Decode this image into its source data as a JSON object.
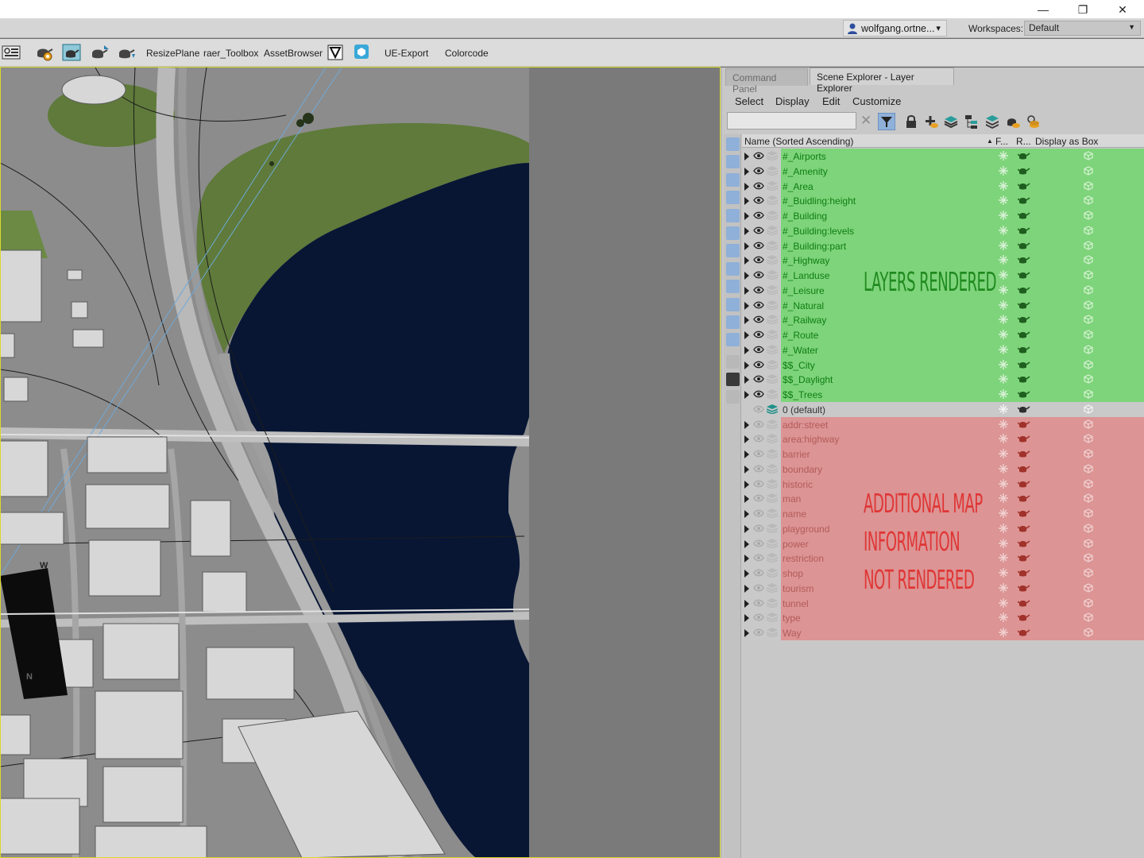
{
  "window": {
    "minimize_glyph": "—",
    "maximize_glyph": "❐",
    "close_glyph": "✕"
  },
  "account": {
    "user_name": "wolfgang.ortne...",
    "user_dropdown": "▾",
    "workspaces_label": "Workspaces:",
    "workspace_value": "Default",
    "workspace_dropdown": "▼"
  },
  "toolbar": {
    "items": [
      "ResizePlane",
      "raer_Toolbox",
      "AssetBrowser",
      "UE-Export",
      "Colorcode"
    ],
    "icons": [
      "grid-settings-icon",
      "teapot-gear-icon",
      "teapot-screen-icon",
      "teapot-arrow-icon",
      "teapot-down-icon",
      "v-logo-icon",
      "cube-badge-icon"
    ]
  },
  "panel": {
    "tabs": [
      "Command Panel",
      "Scene Explorer - Layer Explorer"
    ],
    "menus": [
      "Select",
      "Display",
      "Edit",
      "Customize"
    ],
    "search_placeholder": "",
    "search_clear": "✕",
    "header": {
      "name_col": "Name (Sorted Ascending)",
      "sort_indicator": "▲",
      "freeze_col": "F...",
      "render_col": "R...",
      "box_col": "Display as Box"
    }
  },
  "layers_rendered": [
    "#_Airports",
    "#_Amenity",
    "#_Area",
    "#_Buidling:height",
    "#_Building",
    "#_Building:levels",
    "#_Building:part",
    "#_Highway",
    "#_Landuse",
    "#_Leisure",
    "#_Natural",
    "#_Railway",
    "#_Route",
    "#_Water",
    "$$_City",
    "$$_Daylight",
    "$$_Trees"
  ],
  "default_layer": "0 (default)",
  "layers_not_rendered": [
    "addr:street",
    "area:highway",
    "barrier",
    "boundary",
    "historic",
    "man",
    "name",
    "playground",
    "power",
    "restriction",
    "shop",
    "tourism",
    "tunnel",
    "type",
    "Way"
  ],
  "annotations": {
    "rendered": "LAYERS RENDERED",
    "not_rendered_1": "ADDITIONAL MAP",
    "not_rendered_2": "INFORMATION",
    "not_rendered_3": "NOT RENDERED"
  },
  "viewport": {
    "labels": [
      "W",
      "N"
    ]
  },
  "colors": {
    "rendered_row": "#7ed47a",
    "not_rendered_row": "#dc9494",
    "water": "#081634",
    "grass": "#5f7a3a"
  }
}
